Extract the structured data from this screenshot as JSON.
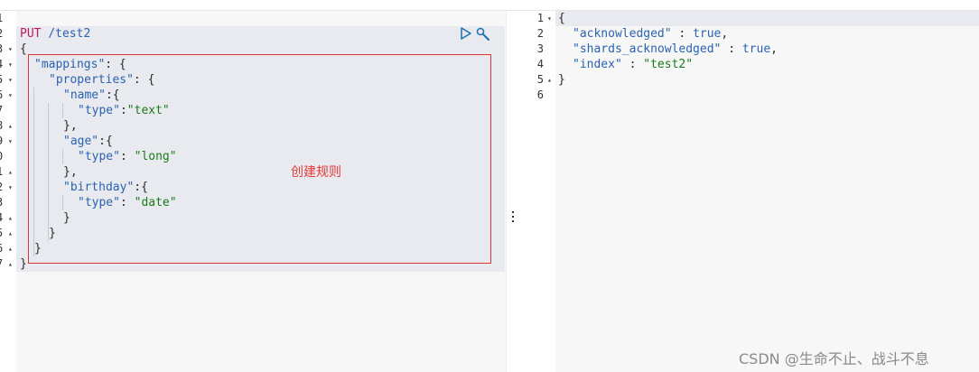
{
  "request": {
    "method": "PUT",
    "path": " /test2",
    "lines": [
      {
        "num": "1",
        "fold": ""
      },
      {
        "num": "2",
        "fold": ""
      },
      {
        "num": "3",
        "fold": "▾"
      },
      {
        "num": "4",
        "fold": "▾"
      },
      {
        "num": "5",
        "fold": "▾"
      },
      {
        "num": "6",
        "fold": "▾"
      },
      {
        "num": "7",
        "fold": ""
      },
      {
        "num": "8",
        "fold": "▴"
      },
      {
        "num": "9",
        "fold": "▾"
      },
      {
        "num": "0",
        "fold": ""
      },
      {
        "num": "1",
        "fold": "▴"
      },
      {
        "num": "2",
        "fold": "▾"
      },
      {
        "num": "3",
        "fold": ""
      },
      {
        "num": "4",
        "fold": "▴"
      },
      {
        "num": "5",
        "fold": "▴"
      },
      {
        "num": "6",
        "fold": "▴"
      },
      {
        "num": "7",
        "fold": "▴"
      }
    ],
    "mappings_key": "\"mappings\"",
    "properties_key": "\"properties\"",
    "name_key": "\"name\"",
    "type_key": "\"type\"",
    "text_val": "\"text\"",
    "age_key": "\"age\"",
    "long_val": "\"long\"",
    "birthday_key": "\"birthday\"",
    "date_val": "\"date\""
  },
  "annotation": "创建规则",
  "response": {
    "lines": [
      {
        "num": "1",
        "fold": "▾"
      },
      {
        "num": "2",
        "fold": ""
      },
      {
        "num": "3",
        "fold": ""
      },
      {
        "num": "4",
        "fold": ""
      },
      {
        "num": "5",
        "fold": "▴"
      },
      {
        "num": "6",
        "fold": ""
      }
    ],
    "ack_key": "\"acknowledged\"",
    "ack_val": "true",
    "shards_key": "\"shards_acknowledged\"",
    "shards_val": "true",
    "index_key": "\"index\"",
    "index_val": "\"test2\""
  },
  "watermark": "CSDN @生命不止、战斗不息",
  "colors": {
    "accent": "#2a62b0",
    "string": "#1a7a1a",
    "method": "#c2185b",
    "annotation": "#e53935"
  }
}
